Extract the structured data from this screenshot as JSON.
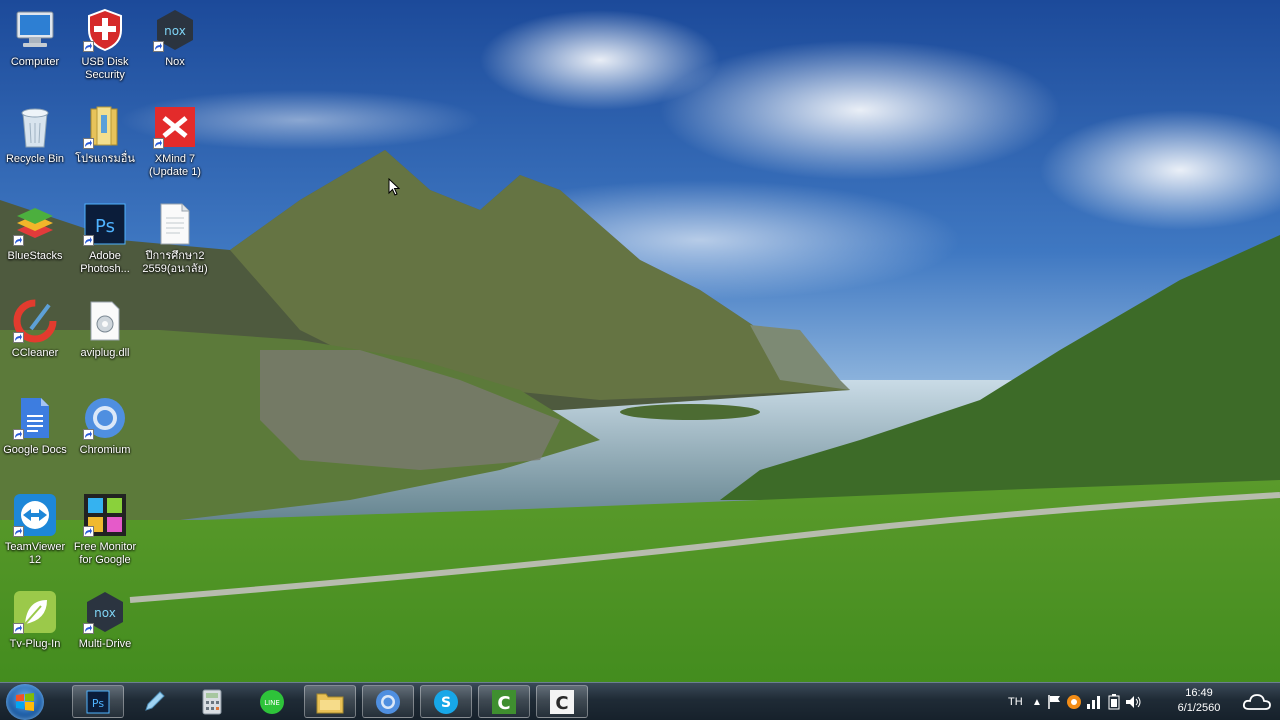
{
  "desktop_icons": [
    {
      "id": "computer",
      "label": "Computer"
    },
    {
      "id": "usb-disk-security",
      "label": "USB Disk Security"
    },
    {
      "id": "nox",
      "label": "Nox"
    },
    {
      "id": "recycle-bin",
      "label": "Recycle Bin"
    },
    {
      "id": "program-folder",
      "label": "โปรแกรมอื่น"
    },
    {
      "id": "xmind",
      "label": "XMind 7 (Update 1)"
    },
    {
      "id": "bluestacks",
      "label": "BlueStacks"
    },
    {
      "id": "photoshop",
      "label": "Adobe Photosh..."
    },
    {
      "id": "document",
      "label": "ปีการศึกษา2 2559(อนาลัย)"
    },
    {
      "id": "ccleaner",
      "label": "CCleaner"
    },
    {
      "id": "aviplug",
      "label": "aviplug.dll"
    },
    {
      "id": "google-docs",
      "label": "Google Docs"
    },
    {
      "id": "chromium",
      "label": "Chromium"
    },
    {
      "id": "teamviewer",
      "label": "TeamViewer 12"
    },
    {
      "id": "free-monitor",
      "label": "Free Monitor for Google"
    },
    {
      "id": "tv-plugin",
      "label": "Tv-Plug-In"
    },
    {
      "id": "multi-drive",
      "label": "Multi-Drive"
    }
  ],
  "taskbar": {
    "pinned": [
      "Photoshop",
      "Pen",
      "Calculator",
      "LINE",
      "Explorer",
      "Chromium",
      "Skype",
      "Camtasia Recorder",
      "Camtasia Studio"
    ]
  },
  "tray": {
    "language": "TH",
    "time": "16:49",
    "date": "6/1/2560"
  }
}
